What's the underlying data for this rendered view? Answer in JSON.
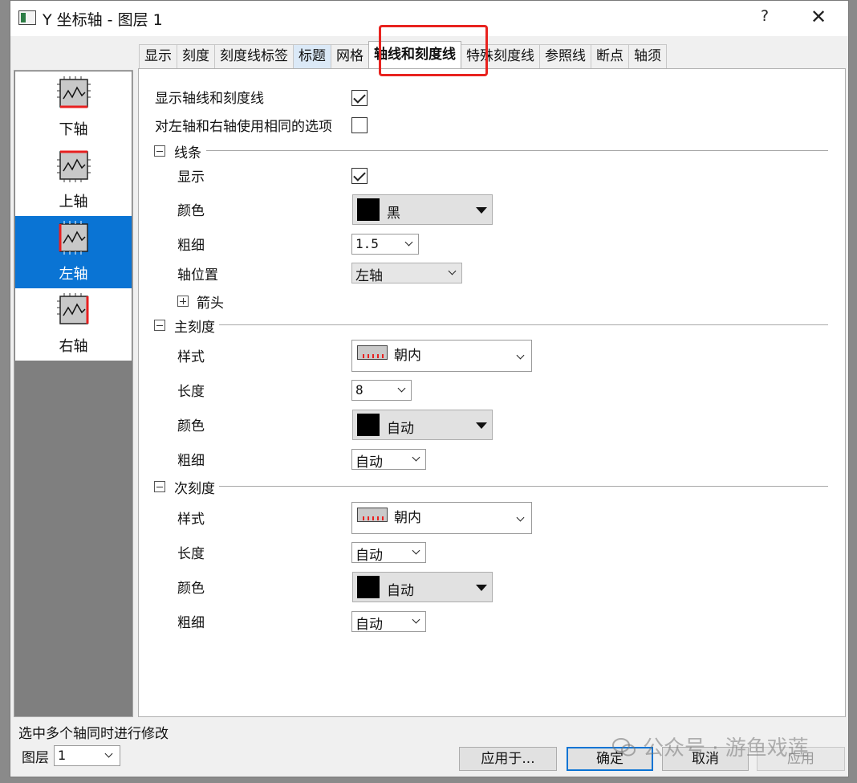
{
  "window": {
    "title": "Y 坐标轴 - 图层 1",
    "help": "?",
    "close": "✕"
  },
  "tabs": [
    "显示",
    "刻度",
    "刻度线标签",
    "标题",
    "网格",
    "轴线和刻度线",
    "特殊刻度线",
    "参照线",
    "断点",
    "轴须"
  ],
  "active_tab": "轴线和刻度线",
  "axes": [
    {
      "label": "下轴",
      "selected": false
    },
    {
      "label": "上轴",
      "selected": false
    },
    {
      "label": "左轴",
      "selected": true
    },
    {
      "label": "右轴",
      "selected": false
    }
  ],
  "top_options": {
    "show_axes_ticks_label": "显示轴线和刻度线",
    "show_axes_ticks_checked": true,
    "same_options_label": "对左轴和右轴使用相同的选项",
    "same_options_checked": false
  },
  "line_section": {
    "title": "线条",
    "show_label": "显示",
    "show_checked": true,
    "color_label": "颜色",
    "color_value": "黑",
    "thickness_label": "粗细",
    "thickness_value": "1.5",
    "axis_pos_label": "轴位置",
    "axis_pos_value": "左轴",
    "arrow_label": "箭头"
  },
  "major_section": {
    "title": "主刻度",
    "style_label": "样式",
    "style_value": "朝内",
    "length_label": "长度",
    "length_value": "8",
    "color_label": "颜色",
    "color_value": "自动",
    "thickness_label": "粗细",
    "thickness_value": "自动"
  },
  "minor_section": {
    "title": "次刻度",
    "style_label": "样式",
    "style_value": "朝内",
    "length_label": "长度",
    "length_value": "自动",
    "color_label": "颜色",
    "color_value": "自动",
    "thickness_label": "粗细",
    "thickness_value": "自动"
  },
  "footer": {
    "note": "选中多个轴同时进行修改",
    "layer_label": "图层",
    "layer_value": "1",
    "apply_to": "应用于...",
    "ok": "确定",
    "cancel": "取消",
    "apply": "应用"
  },
  "watermark": "公众号 · 游鱼戏莲",
  "colors": {
    "highlight": "#e8231f",
    "selected": "#0a74d4",
    "tick_red": "#e82020"
  }
}
